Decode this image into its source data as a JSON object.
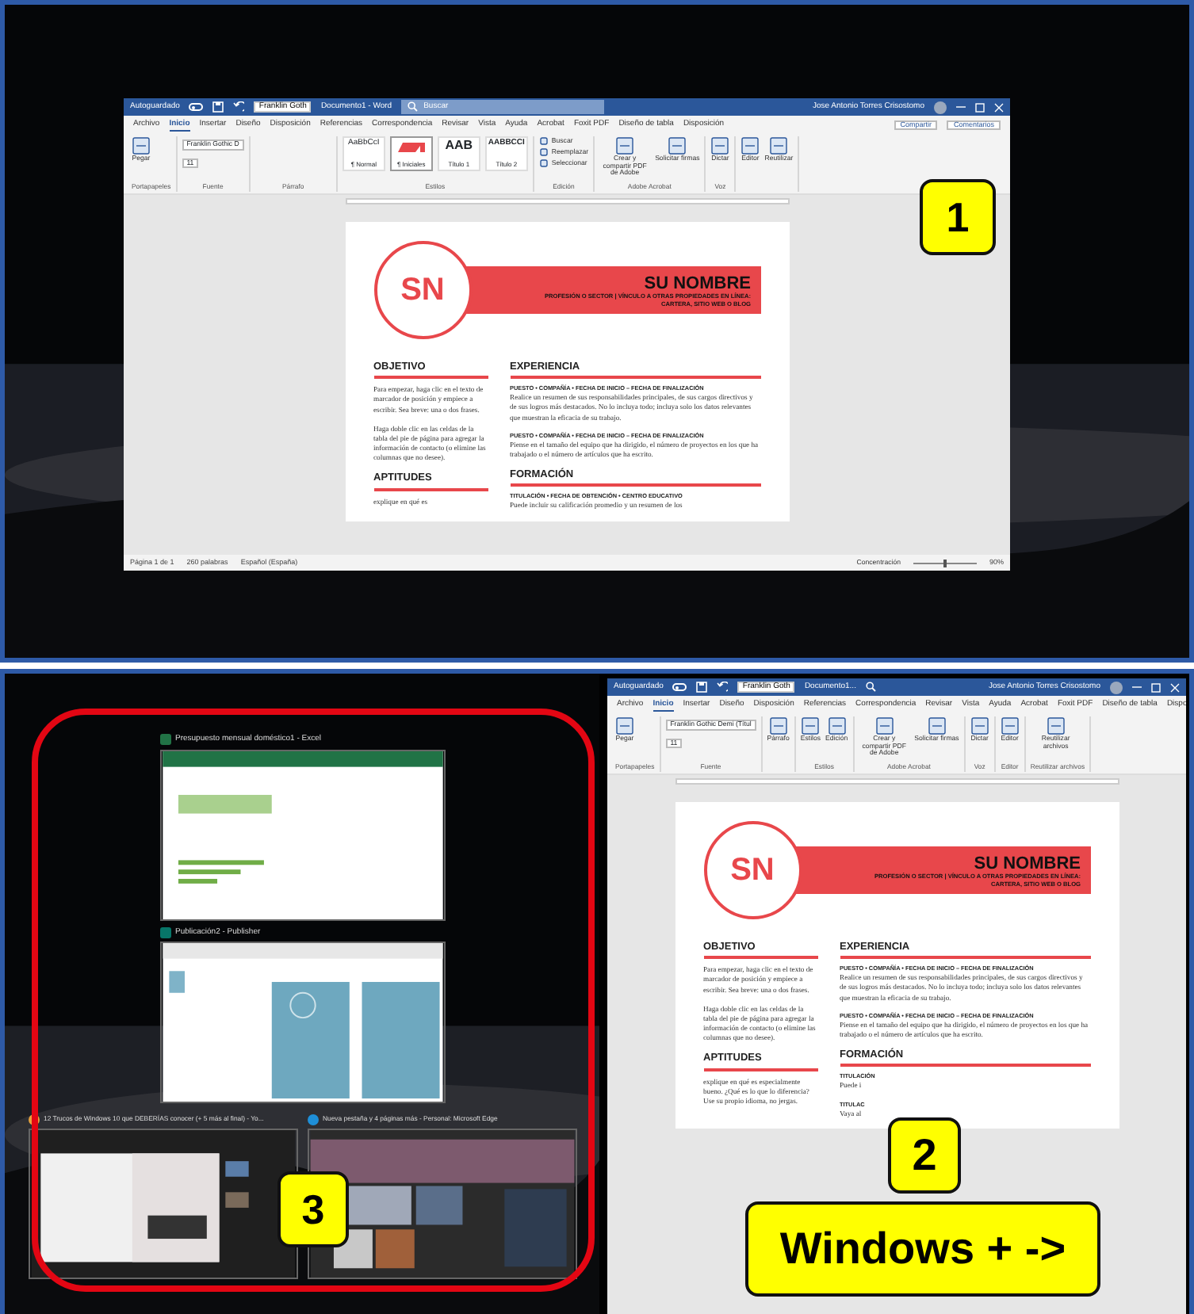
{
  "top_window": {
    "title_bar": {
      "autosave_label": "Autoguardado",
      "autosave_on": false,
      "font_box": "Franklin Goth",
      "document_title": "Documento1 - Word",
      "search_placeholder": "Buscar",
      "user": "Jose Antonio Torres Crisostomo"
    },
    "tabs": [
      {
        "label": "Archivo",
        "selected": false
      },
      {
        "label": "Inicio",
        "selected": true
      },
      {
        "label": "Insertar",
        "selected": false
      },
      {
        "label": "Diseño",
        "selected": false
      },
      {
        "label": "Disposición",
        "selected": false
      },
      {
        "label": "Referencias",
        "selected": false
      },
      {
        "label": "Correspondencia",
        "selected": false
      },
      {
        "label": "Revisar",
        "selected": false
      },
      {
        "label": "Vista",
        "selected": false
      },
      {
        "label": "Ayuda",
        "selected": false
      },
      {
        "label": "Acrobat",
        "selected": false
      },
      {
        "label": "Foxit PDF",
        "selected": false
      },
      {
        "label": "Diseño de tabla",
        "selected": false
      },
      {
        "label": "Disposición",
        "selected": false
      }
    ],
    "share_buttons": [
      "Compartir",
      "Comentarios"
    ],
    "ribbon": [
      {
        "label": "Portapapeles",
        "buttons": [
          {
            "kind": "large",
            "label": "Pegar"
          }
        ]
      },
      {
        "label": "Fuente",
        "buttons": [
          {
            "kind": "field",
            "label": "Franklin Gothic D"
          },
          {
            "kind": "field",
            "label": "11"
          }
        ]
      },
      {
        "label": "Párrafo"
      },
      {
        "label": "Estilos",
        "buttons": [
          {
            "kind": "style",
            "sample": "AaBbCcI",
            "label": "¶ Normal"
          },
          {
            "kind": "style_graphic",
            "label": "¶ Iniciales"
          },
          {
            "kind": "style",
            "sample": "AAB",
            "label": "Título 1"
          },
          {
            "kind": "style",
            "sample": "AABBCCI",
            "label": "Título 2"
          }
        ]
      },
      {
        "label": "Edición",
        "buttons": [
          {
            "kind": "small",
            "label": "Buscar"
          },
          {
            "kind": "small",
            "label": "Reemplazar"
          },
          {
            "kind": "small",
            "label": "Seleccionar"
          }
        ]
      },
      {
        "label": "Adobe Acrobat",
        "buttons": [
          {
            "kind": "large",
            "label": "Crear y compartir PDF de Adobe"
          },
          {
            "kind": "large",
            "label": "Solicitar firmas"
          }
        ]
      },
      {
        "label": "Voz",
        "buttons": [
          {
            "kind": "large",
            "label": "Dictar"
          }
        ]
      },
      {
        "buttons": [
          {
            "kind": "large",
            "label": "Editor"
          },
          {
            "kind": "large",
            "label": "Reutilizar"
          }
        ]
      }
    ],
    "document": {
      "monogram": "SN",
      "name": "SU NOMBRE",
      "subtitle": "PROFESIÓN O SECTOR | VÍNCULO A OTRAS PROPIEDADES EN LÍNEA: CARTERA, SITIO WEB O BLOG",
      "left": [
        {
          "kind": "heading",
          "text": "OBJETIVO"
        },
        {
          "kind": "paragraph",
          "text": "Para empezar, haga clic en el texto de marcador de posición y empiece a escribir. Sea breve: una o dos frases."
        },
        {
          "kind": "paragraph",
          "text": "Haga doble clic en las celdas de la tabla del pie de página para agregar la información de contacto (o elimine las columnas que no desee)."
        },
        {
          "kind": "heading",
          "text": "APTITUDES"
        },
        {
          "kind": "paragraph",
          "text": "explique en qué es"
        }
      ],
      "right": [
        {
          "kind": "heading",
          "text": "EXPERIENCIA"
        },
        {
          "kind": "entry_title",
          "text": "PUESTO • COMPAÑÍA • FECHA DE INICIO – FECHA DE FINALIZACIÓN"
        },
        {
          "kind": "paragraph",
          "text": "Realice un resumen de sus responsabilidades principales, de sus cargos directivos y de sus logros más destacados. No lo incluya todo; incluya solo los datos relevantes que muestran la eficacia de su trabajo."
        },
        {
          "kind": "entry_title",
          "text": "PUESTO • COMPAÑÍA • FECHA DE INICIO – FECHA DE FINALIZACIÓN"
        },
        {
          "kind": "paragraph",
          "text": "Piense en el tamaño del equipo que ha dirigido, el número de proyectos en los que ha trabajado o el número de artículos que ha escrito."
        },
        {
          "kind": "heading",
          "text": "FORMACIÓN"
        },
        {
          "kind": "entry_title",
          "text": "TITULACIÓN • FECHA DE OBTENCIÓN • CENTRO EDUCATIVO"
        },
        {
          "kind": "paragraph",
          "text": "Puede incluir su calificación promedio y un resumen de los"
        }
      ]
    },
    "status_bar": {
      "left": [
        "Página 1 de 1",
        "260 palabras",
        "Español (España)"
      ],
      "focus": "Concentración",
      "zoom_slider": {
        "level": 0.5
      },
      "zoom": "90%"
    }
  },
  "top_callout": {
    "text": "1"
  },
  "snap_assist": {
    "windows": [
      {
        "title": "Presupuesto mensual doméstico1 - Excel",
        "kind": "excel"
      },
      {
        "title": "Publicación2 - Publisher",
        "kind": "publisher"
      },
      {
        "title": "12 Trucos de Windows 10 que DEBERÍAS conocer (+ 5 más al final) - Yo...",
        "kind": "chrome"
      },
      {
        "title": "Nueva pestaña y 4 páginas más - Personal: Microsoft Edge",
        "kind": "edge"
      }
    ],
    "callout": {
      "text": "3"
    }
  },
  "bottom_window": {
    "title_bar": {
      "autosave_label": "Autoguardado",
      "autosave_on": false,
      "font_box": "Franklin Goth",
      "document_title": "Documento1...",
      "user": "Jose Antonio Torres Crisostomo"
    },
    "tabs": [
      {
        "label": "Archivo",
        "selected": false
      },
      {
        "label": "Inicio",
        "selected": true
      },
      {
        "label": "Insertar",
        "selected": false
      },
      {
        "label": "Diseño",
        "selected": false
      },
      {
        "label": "Disposición",
        "selected": false
      },
      {
        "label": "Referencias",
        "selected": false
      },
      {
        "label": "Correspondencia",
        "selected": false
      },
      {
        "label": "Revisar",
        "selected": false
      },
      {
        "label": "Vista",
        "selected": false
      },
      {
        "label": "Ayuda",
        "selected": false
      },
      {
        "label": "Acrobat",
        "selected": false
      },
      {
        "label": "Foxit PDF",
        "selected": false
      },
      {
        "label": "Diseño de tabla",
        "selected": false
      },
      {
        "label": "Dispo",
        "selected": false
      }
    ],
    "ribbon": [
      {
        "label": "Portapapeles",
        "buttons": [
          {
            "kind": "large",
            "label": "Pegar"
          }
        ]
      },
      {
        "label": "Fuente",
        "buttons": [
          {
            "kind": "field",
            "label": "Franklin Gothic Demi (Títul"
          },
          {
            "kind": "field",
            "label": "11"
          }
        ]
      },
      {
        "buttons": [
          {
            "kind": "large",
            "label": "Párrafo"
          }
        ]
      },
      {
        "label": "Estilos",
        "buttons": [
          {
            "kind": "large",
            "label": "Estilos"
          },
          {
            "kind": "large",
            "label": "Edición"
          }
        ]
      },
      {
        "label": "Adobe Acrobat",
        "buttons": [
          {
            "kind": "large",
            "label": "Crear y compartir PDF de Adobe"
          },
          {
            "kind": "large",
            "label": "Solicitar firmas"
          }
        ]
      },
      {
        "label": "Voz",
        "buttons": [
          {
            "kind": "large",
            "label": "Dictar"
          }
        ]
      },
      {
        "label": "Editor",
        "buttons": [
          {
            "kind": "large",
            "label": "Editor"
          }
        ]
      },
      {
        "label": "Reutilizar archivos",
        "buttons": [
          {
            "kind": "large",
            "label": "Reutilizar archivos"
          }
        ]
      }
    ],
    "document": {
      "monogram": "SN",
      "name": "SU NOMBRE",
      "subtitle": "PROFESIÓN O SECTOR | VÍNCULO A OTRAS PROPIEDADES EN LÍNEA: CARTERA, SITIO WEB O BLOG",
      "left": [
        {
          "kind": "heading",
          "text": "OBJETIVO"
        },
        {
          "kind": "paragraph",
          "text": "Para empezar, haga clic en el texto de marcador de posición y empiece a escribir. Sea breve: una o dos frases."
        },
        {
          "kind": "paragraph",
          "text": "Haga doble clic en las celdas de la tabla del pie de página para agregar la información de contacto (o elimine las columnas que no desee)."
        },
        {
          "kind": "heading",
          "text": "APTITUDES"
        },
        {
          "kind": "paragraph",
          "text": "explique en qué es especialmente bueno. ¿Qué es lo que lo diferencia? Use su propio idioma, no jergas."
        }
      ],
      "right": [
        {
          "kind": "heading",
          "text": "EXPERIENCIA"
        },
        {
          "kind": "entry_title",
          "text": "PUESTO • COMPAÑÍA • FECHA DE INICIO – FECHA DE FINALIZACIÓN"
        },
        {
          "kind": "paragraph",
          "text": "Realice un resumen de sus responsabilidades principales, de sus cargos directivos y de sus logros más destacados. No lo incluya todo; incluya solo los datos relevantes que muestran la eficacia de su trabajo."
        },
        {
          "kind": "entry_title",
          "text": "PUESTO • COMPAÑÍA • FECHA DE INICIO – FECHA DE FINALIZACIÓN"
        },
        {
          "kind": "paragraph",
          "text": "Piense en el tamaño del equipo que ha dirigido, el número de proyectos en los que ha trabajado o el número de artículos que ha escrito."
        },
        {
          "kind": "heading",
          "text": "FORMACIÓN"
        },
        {
          "kind": "entry_title",
          "text": "TITULACIÓN"
        },
        {
          "kind": "paragraph",
          "text": "Puede i"
        },
        {
          "kind": "entry_title",
          "text": "TITULAC"
        },
        {
          "kind": "paragraph",
          "text": "Vaya al"
        }
      ]
    }
  },
  "bottom_callouts": [
    {
      "text": "2"
    },
    {
      "text": "Windows + ->"
    }
  ]
}
